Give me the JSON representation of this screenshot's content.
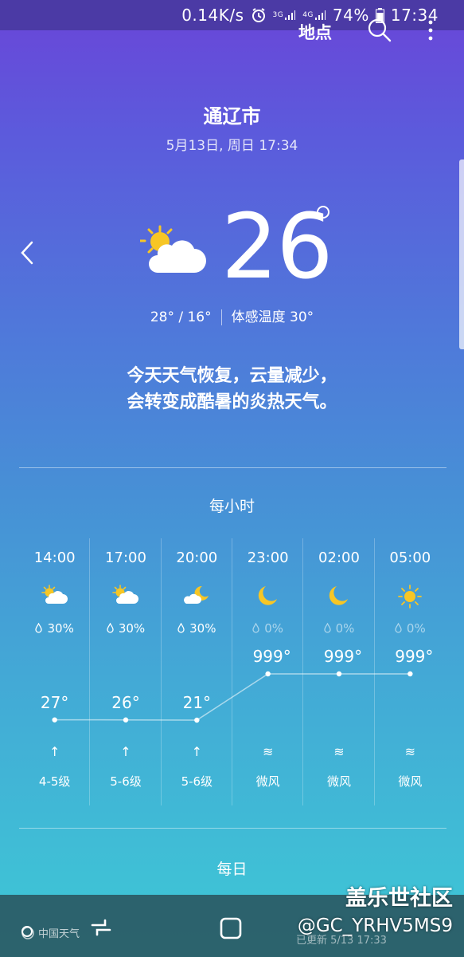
{
  "status": {
    "speed": "0.14K/s",
    "net1": "3G",
    "net2": "4G",
    "battery": "74%",
    "time": "17:34"
  },
  "toolbar": {
    "place_label": "地点"
  },
  "location": {
    "city": "通辽市",
    "datetime": "5月13日, 周日 17:34"
  },
  "current": {
    "temp": "26",
    "range": "28° / 16°",
    "feels_like": "体感温度 30°",
    "summary_line1": "今天天气恢复，云量减少，",
    "summary_line2": "会转变成酷暑的炎热天气。"
  },
  "hourly": {
    "title": "每小时",
    "items": [
      {
        "time": "14:00",
        "icon": "partly-cloudy-day-icon",
        "precip": "30%",
        "temp": "27°",
        "temp_value": 27,
        "wind_icon": "↑",
        "wind": "4-5级"
      },
      {
        "time": "17:00",
        "icon": "partly-cloudy-day-icon",
        "precip": "30%",
        "temp": "26°",
        "temp_value": 26,
        "wind_icon": "↑",
        "wind": "5-6级"
      },
      {
        "time": "20:00",
        "icon": "partly-cloudy-night-icon",
        "precip": "30%",
        "temp": "21°",
        "temp_value": 21,
        "wind_icon": "↑",
        "wind": "5-6级"
      },
      {
        "time": "23:00",
        "icon": "moon-icon",
        "precip": "0%",
        "temp": "999°",
        "temp_value": 999,
        "wind_icon": "≋",
        "wind": "微风"
      },
      {
        "time": "02:00",
        "icon": "moon-icon",
        "precip": "0%",
        "temp": "999°",
        "temp_value": 999,
        "wind_icon": "≋",
        "wind": "微风"
      },
      {
        "time": "05:00",
        "icon": "sun-icon",
        "precip": "0%",
        "temp": "999°",
        "temp_value": 999,
        "wind_icon": "≋",
        "wind": "微风"
      }
    ]
  },
  "daily": {
    "title": "每日"
  },
  "footer": {
    "logo_text": "中国天气",
    "updated": "已更新 5/13 17:33"
  },
  "watermark": {
    "line1": "盖乐世社区",
    "line2": "@GC_YRHV5MS9"
  },
  "colors": {
    "sun": "#f7c625",
    "moon": "#f7c625",
    "cloud": "#ffffff"
  }
}
